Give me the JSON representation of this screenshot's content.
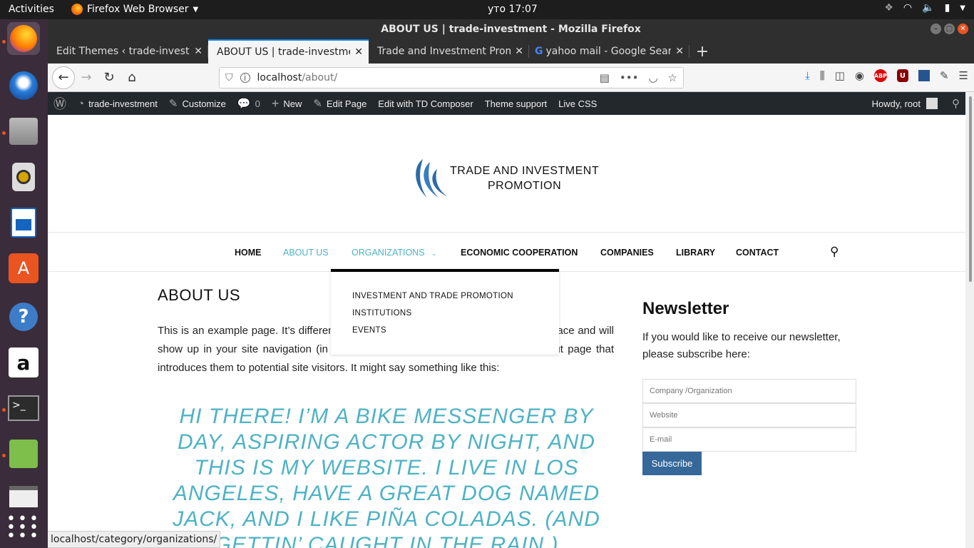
{
  "topbar": {
    "activities": "Activities",
    "app_name": "Firefox Web Browser",
    "clock": "уто 17:07"
  },
  "window": {
    "title": "ABOUT US | trade-investment - Mozilla Firefox"
  },
  "tabs": [
    {
      "label": "Edit Themes ‹ trade-investment",
      "active": false
    },
    {
      "label": "ABOUT US | trade-investment",
      "active": true
    },
    {
      "label": "Trade and Investment Promotion",
      "active": false
    },
    {
      "label": "yahoo mail - Google Search",
      "active": false
    }
  ],
  "url": {
    "host": "localhost",
    "path": "/about/"
  },
  "adminbar": {
    "site": "trade-investment",
    "customize": "Customize",
    "comments": "0",
    "new": "New",
    "edit_page": "Edit Page",
    "td_composer": "Edit with TD Composer",
    "theme_support": "Theme support",
    "live_css": "Live CSS",
    "howdy": "Howdy, root"
  },
  "logo": {
    "line1": "TRADE AND INVESTMENT",
    "line2": "PROMOTION"
  },
  "menu": {
    "home": "HOME",
    "about": "ABOUT US",
    "organizations": "ORGANIZATIONS",
    "economic": "ECONOMIC COOPERATION",
    "companies": "COMPANIES",
    "library": "LIBRARY",
    "contact": "CONTACT"
  },
  "dropdown": {
    "item1_line1": "INVESTMENT AND TRADE PROMOTION",
    "item1_line2": "INSTITUTIONS",
    "item2": "EVENTS"
  },
  "content": {
    "title": "ABOUT US",
    "body": "This is an example page. It’s different from a blog post because it will stay in one place and will show up in your site navigation (in most themes). Most people start with an About page that introduces them to potential site visitors. It might say something like this:",
    "quote": "HI THERE! I’M A BIKE MESSENGER BY DAY, ASPIRING ACTOR BY NIGHT, AND THIS IS MY WEBSITE. I LIVE IN LOS ANGELES, HAVE A GREAT DOG NAMED JACK, AND I LIKE PIÑA COLADAS. (AND GETTIN’ CAUGHT IN THE RAIN.)"
  },
  "newsletter": {
    "heading": "Newsletter",
    "text": "If you would like to receive our newsletter, please subscribe here:",
    "company_placeholder": "Company /Organization",
    "website_placeholder": "Website",
    "email_placeholder": "E-mail",
    "subscribe": "Subscribe"
  },
  "status_url": "localhost/category/organizations/",
  "colors": {
    "accent_cyan": "#4db2c4",
    "subscribe_blue": "#366899",
    "ubuntu_orange": "#e95420",
    "adminbar": "#23282d"
  }
}
